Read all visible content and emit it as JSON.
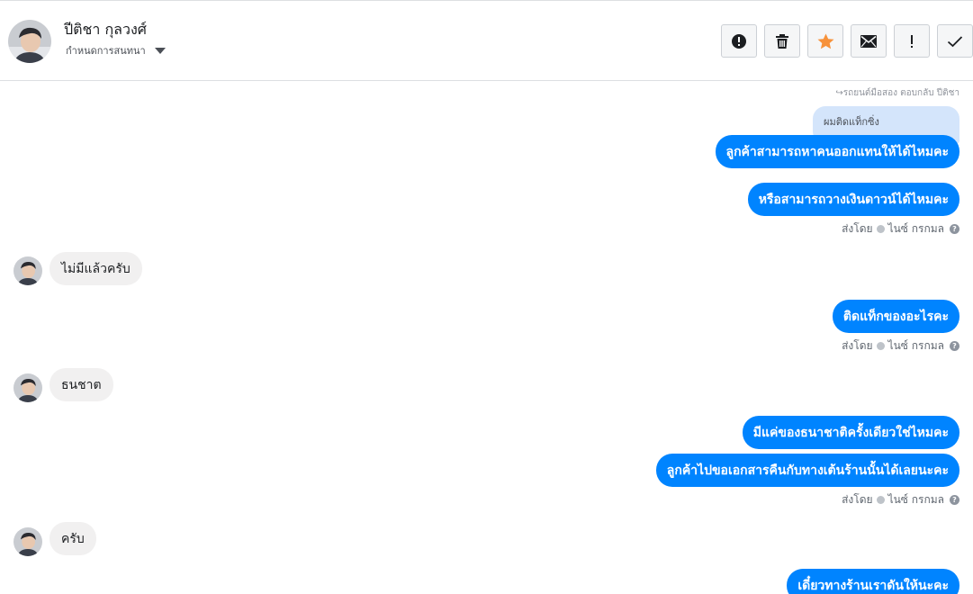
{
  "header": {
    "contact_name": "ปีติชา กุลวงศ์",
    "assign_label": "กำหนดการสนทนา",
    "avatar_icon": "person-photo",
    "actions": [
      {
        "name": "alert-circle-icon"
      },
      {
        "name": "trash-icon"
      },
      {
        "name": "star-icon",
        "color": "#f7923b"
      },
      {
        "name": "envelope-icon"
      },
      {
        "name": "exclamation-icon"
      },
      {
        "name": "checkmark-icon"
      }
    ]
  },
  "chat": {
    "forward_note": "↪รถยนต์มือสอง ตอบกลับ ปีติชา",
    "reply_quote": "ผมติดแท็กซิ่ง",
    "sent_by_label": "ส่งโดย",
    "agent_name": "ไนซ์ กรกมล",
    "messages": [
      {
        "text": "ลูกค้าสามารถหาคนออกแทนให้ได้ไหมคะ"
      },
      {
        "text": "หรือสามารถวางเงินดาวน์ได้ไหมคะ"
      },
      {
        "text": "ไม่มีแล้วครับ"
      },
      {
        "text": "ติดแท็กของอะไรคะ"
      },
      {
        "text": "ธนชาต"
      },
      {
        "text": "มีแค่ของธนาชาติครั้งเดียวใช่ไหมคะ"
      },
      {
        "text": "ลูกค้าไปขอเอกสารคืนกับทางเต้นร้านนั้นได้เลยนะคะ"
      },
      {
        "text": "ครับ"
      },
      {
        "text": "เดี๋ยวทางร้านเราดันให้นะคะ"
      }
    ]
  },
  "colors": {
    "outgoing_bubble": "#0084ff",
    "incoming_bubble": "#f1f0f0",
    "reply_bubble": "#d4e5fb"
  }
}
